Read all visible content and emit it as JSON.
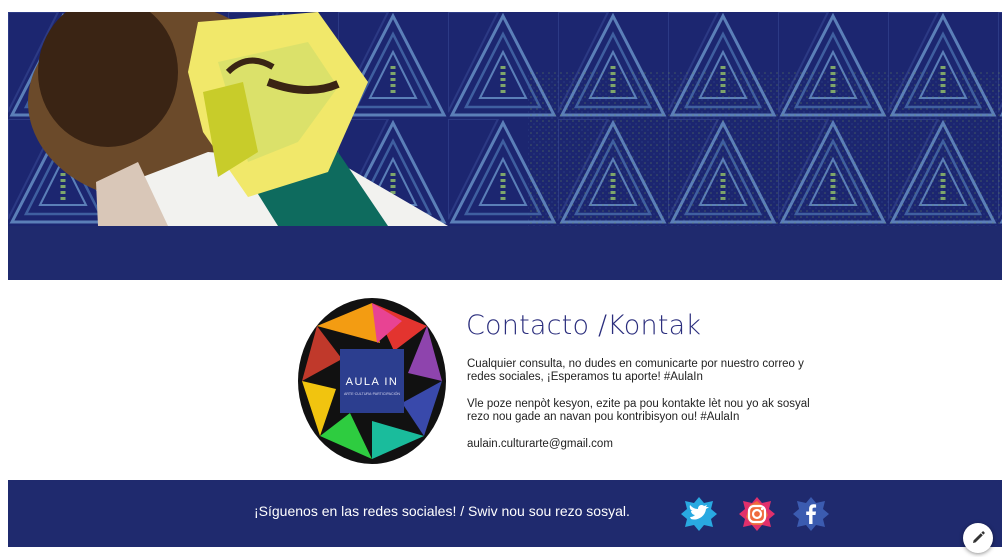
{
  "contact": {
    "title": "Contacto /Kontak",
    "paragraph_es": "Cualquier consulta, no dudes en comunicarte por nuestro correo y redes sociales, ¡Esperamos tu aporte! #AulaIn",
    "paragraph_ht": "Vle poze nenpòt kesyon, ezite pa pou kontakte lèt nou yo ak sosyal rezo nou gade an navan pou kontribisyon ou! #AulaIn",
    "email": "aulain.culturarte@gmail.com"
  },
  "logo": {
    "name": "AULA IN",
    "tagline": "ARTE·CULTURA·PARTICIPACIÓN"
  },
  "footer": {
    "follow_text": "¡Síguenos en las redes sociales! / Swiv nou sou rezo sosyal.",
    "social": [
      {
        "network": "twitter",
        "icon": "twitter-icon",
        "color": "#1da1f2"
      },
      {
        "network": "instagram",
        "icon": "instagram-icon",
        "color": "#e1306c"
      },
      {
        "network": "facebook",
        "icon": "facebook-icon",
        "color": "#3b5998"
      }
    ]
  },
  "colors": {
    "brand_navy": "#1f2a6e",
    "title_color": "#2b2e7d"
  },
  "icons": {
    "edit": "pencil-icon"
  }
}
